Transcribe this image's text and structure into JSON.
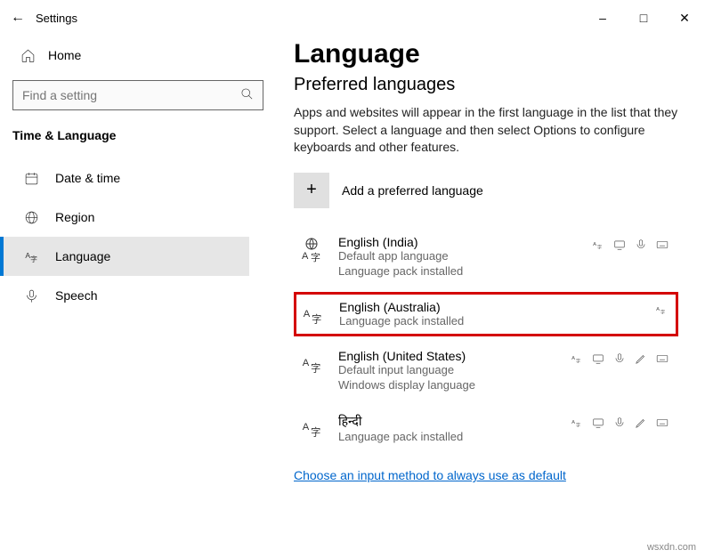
{
  "window": {
    "title": "Settings"
  },
  "sidebar": {
    "home": "Home",
    "search_placeholder": "Find a setting",
    "category": "Time & Language",
    "items": [
      {
        "label": "Date & time"
      },
      {
        "label": "Region"
      },
      {
        "label": "Language"
      },
      {
        "label": "Speech"
      }
    ]
  },
  "main": {
    "heading": "Language",
    "subheading": "Preferred languages",
    "description": "Apps and websites will appear in the first language in the list that they support. Select a language and then select Options to configure keyboards and other features.",
    "add_label": "Add a preferred language",
    "languages": [
      {
        "name": "English (India)",
        "line1": "Default app language",
        "line2": "Language pack installed"
      },
      {
        "name": "English (Australia)",
        "line1": "Language pack installed",
        "line2": ""
      },
      {
        "name": "English (United States)",
        "line1": "Default input language",
        "line2": "Windows display language"
      },
      {
        "name": "हिन्दी",
        "line1": "Language pack installed",
        "line2": ""
      }
    ],
    "link": "Choose an input method to always use as default"
  },
  "watermark": "wsxdn.com"
}
